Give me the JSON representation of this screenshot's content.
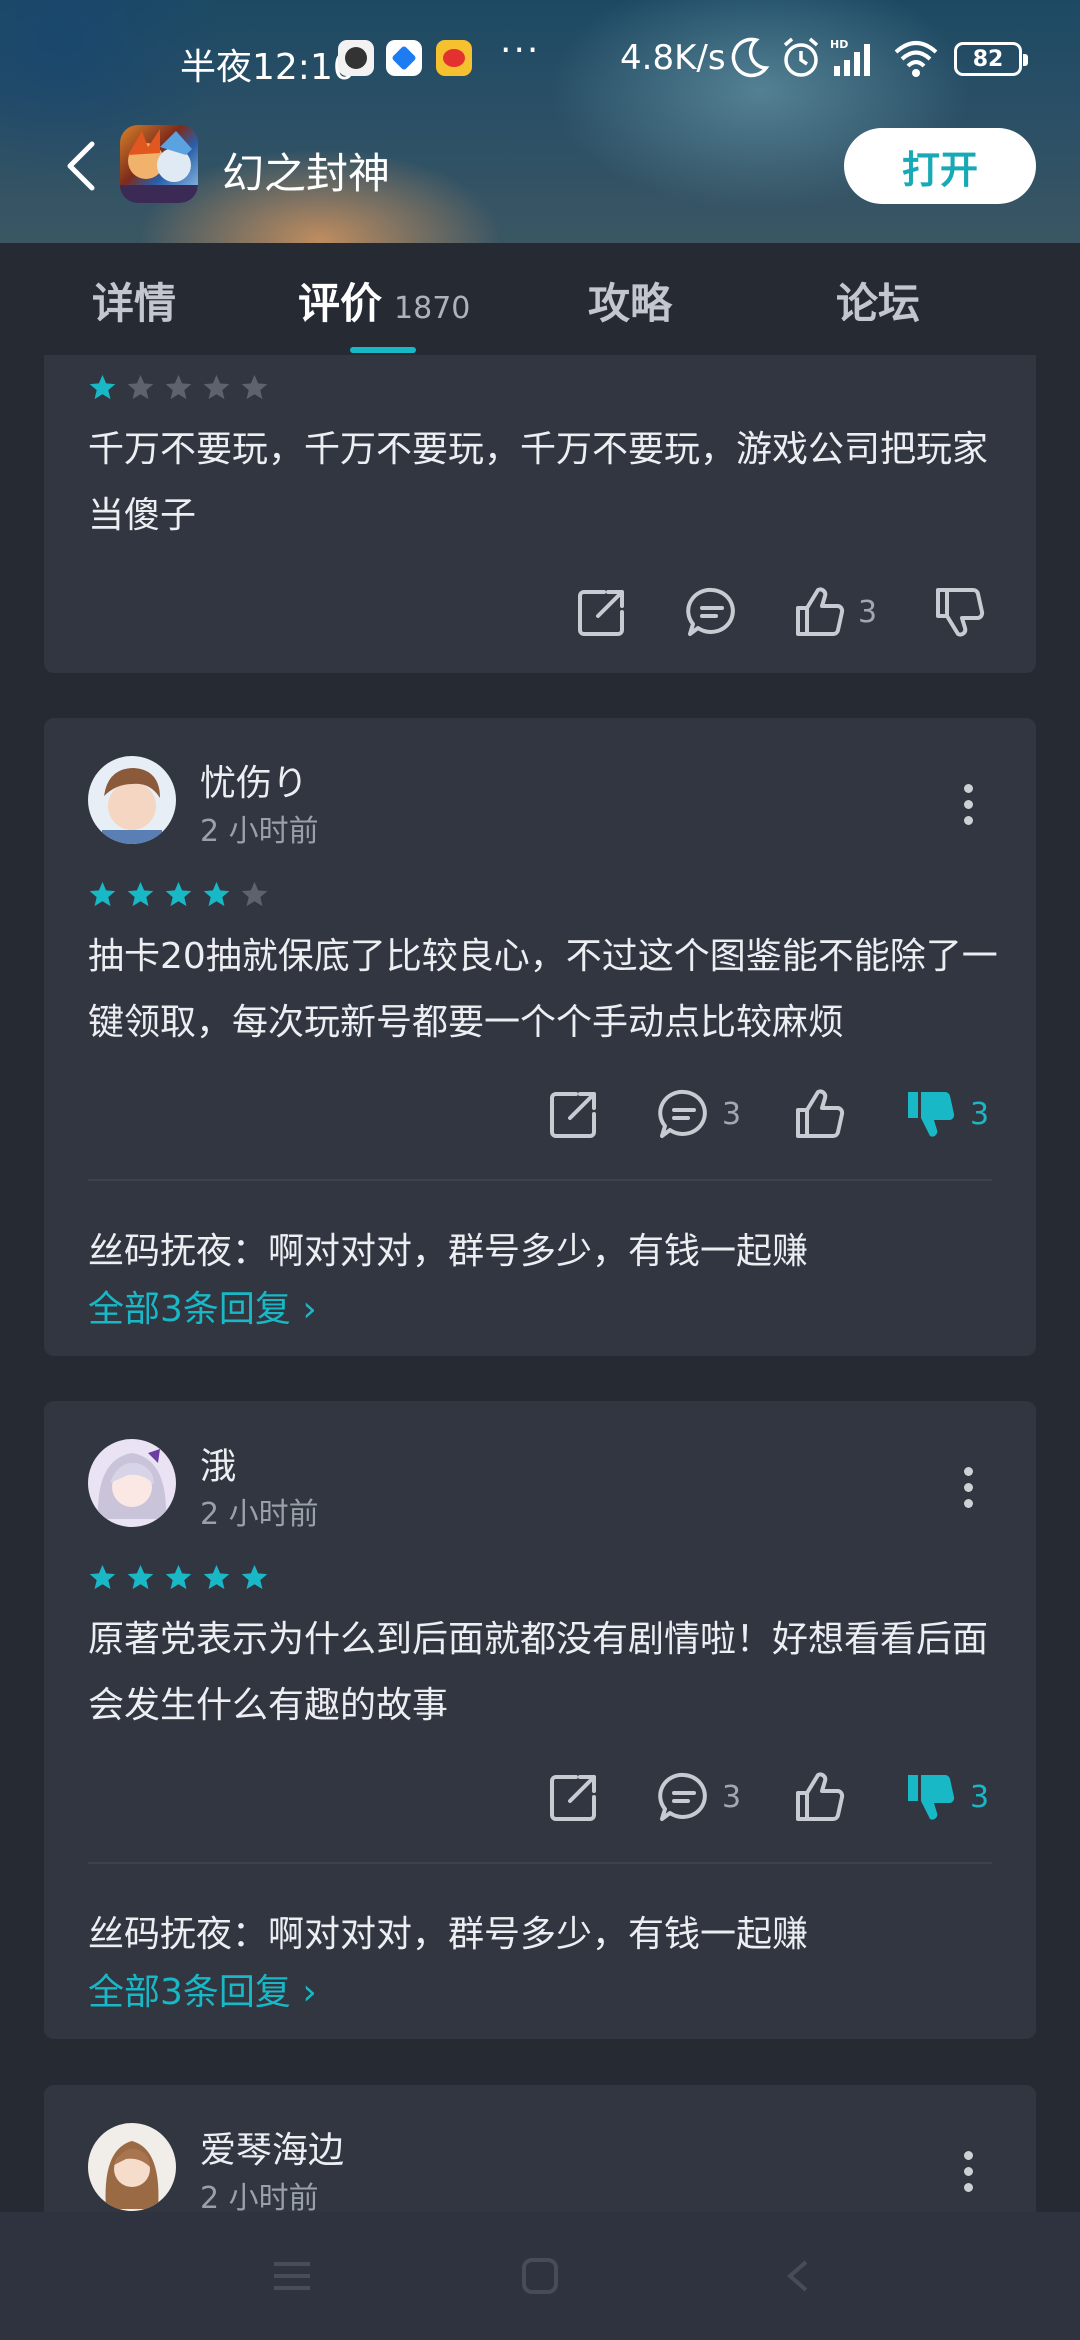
{
  "status": {
    "time": "半夜12:10",
    "dots": "···",
    "speed": "4.8K/s",
    "battery": "82"
  },
  "header": {
    "app_title": "幻之封神",
    "open_label": "打开"
  },
  "tabs": {
    "items": [
      {
        "label": "详情"
      },
      {
        "label": "评价",
        "count": "1870"
      },
      {
        "label": "攻略"
      },
      {
        "label": "论坛"
      }
    ],
    "active_index": 1
  },
  "colors": {
    "accent": "#19b8c6",
    "card": "#313641",
    "background": "#262a33"
  },
  "reviews": [
    {
      "rating": 1,
      "text": "千万不要玩，千万不要玩，千万不要玩，游戏公司把玩家当傻子",
      "like_count": "3"
    },
    {
      "username": "忧伤り",
      "time": "2 小时前",
      "rating": 4,
      "text": "抽卡20抽就保底了比较良心，不过这个图鉴能不能除了一键领取，每次玩新号都要一个个手动点比较麻烦",
      "comment_count": "3",
      "dislike_count": "3",
      "reply": "丝码抚夜：啊对对对，群号多少，有钱一起赚",
      "reply_link": "全部3条回复 ›"
    },
    {
      "username": "涐",
      "time": "2 小时前",
      "rating": 5,
      "text": "原著党表示为什么到后面就都没有剧情啦！好想看看后面会发生什么有趣的故事",
      "comment_count": "3",
      "dislike_count": "3",
      "reply": "丝码抚夜：啊对对对，群号多少，有钱一起赚",
      "reply_link": "全部3条回复 ›"
    },
    {
      "username": "爱琴海边",
      "time": "2 小时前"
    }
  ]
}
